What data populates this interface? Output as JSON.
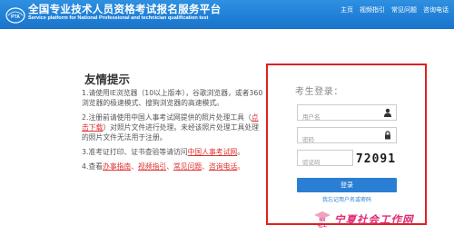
{
  "header": {
    "title": "全国专业技术人员资格考试报名服务平台",
    "subtitle": "Service platform for National Professional and technician qualification test",
    "logo_text": "PTA",
    "nav": [
      "主页",
      "视频指引",
      "常见问题",
      "咨询电话"
    ]
  },
  "tips": {
    "title": "友情提示",
    "item1": "1.请使用IE浏览器（10以上版本），谷歌浏览器，或者360浏览器的极速模式、搜狗浏览器的高速模式。",
    "item2_a": "2.注册前请使用中国人事考试网提供的照片处理工具（",
    "item2_link": "点击下载",
    "item2_b": "）对照片文件进行处理。未经该照片处理工具处理的照片文件无法用于注册。",
    "item3_a": "3.准考证打印、证书查验等请访问",
    "item3_link": "中国人事考试网",
    "item3_b": "。",
    "item4_a": "4.查看",
    "item4_links": [
      "办事指南",
      "视频指引",
      "常见问题",
      "咨询电话"
    ],
    "item4_seps": [
      "、",
      "、",
      "、",
      "。"
    ]
  },
  "login": {
    "title": "考生登录：",
    "username_placeholder": "用户名",
    "password_placeholder": "密码",
    "captcha_placeholder": "验证码",
    "captcha_text": "72091",
    "login_button": "登录",
    "forgot_link": "我忘记用户名或密码"
  },
  "watermark": {
    "logo_text": "NX\n社工",
    "text": "宁夏社会工作网"
  },
  "colors": {
    "header_blue": "#1f7fd6",
    "accent_red": "#e02020",
    "button_blue": "#2a7fd4",
    "watermark_pink": "#e02c74"
  },
  "icons": {
    "username_icon": "user-icon",
    "password_icon": "lock-icon"
  }
}
